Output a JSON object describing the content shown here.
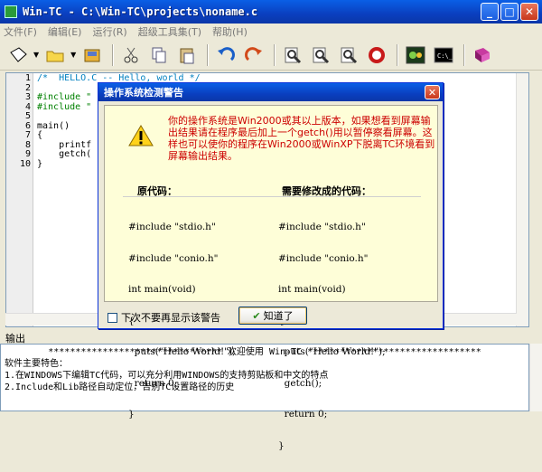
{
  "window": {
    "title": "Win-TC - C:\\Win-TC\\projects\\noname.c"
  },
  "menu": [
    "文件(F)",
    "编辑(E)",
    "运行(R)",
    "超级工具集(T)",
    "帮助(H)"
  ],
  "toolbar": {
    "icons": [
      "new-file-icon",
      "open-folder-icon",
      "save-disk-icon",
      "cut-icon",
      "copy-icon",
      "paste-icon",
      "undo-icon",
      "redo-icon",
      "find-icon",
      "find-next-icon",
      "replace-icon",
      "compile-run-icon",
      "build-icon",
      "dos-console-icon",
      "help-book-icon"
    ],
    "colors": {
      "accent": "#0a3fbf",
      "error": "#cc0000"
    }
  },
  "editor": {
    "line_numbers": [
      "1",
      "2",
      "3",
      "4",
      "5",
      "6",
      "7",
      "8",
      "9",
      "10"
    ],
    "lines": [
      "/*  HELLO.C -- Hello, world */",
      "",
      "#include \"",
      "#include \"",
      "",
      "main()",
      "{",
      "    printf",
      "    getch(",
      "}"
    ]
  },
  "dialog": {
    "title": "操作系统检测警告",
    "message": "你的操作系统是Win2000或其以上版本，如果想看到屏幕输出结果请在程序最后加上一个getch()用以暂停察看屏幕。这样也可以使你的程序在Win2000或WinXP下脱离TC环境看到屏幕输出结果。",
    "original_header": "原代码：",
    "modified_header": "需要修改成的代码：",
    "original_code": [
      "#include \"stdio.h\"",
      "#include \"conio.h\"",
      "int main(void)",
      "{",
      "  puts(\"Hello World!\");",
      "  return 0;",
      "}"
    ],
    "modified_code": [
      "#include \"stdio.h\"",
      "#include \"conio.h\"",
      "int main(void)",
      "{",
      "  puts(\"Hello World!\");",
      "  getch();",
      "  return 0;",
      "}"
    ],
    "checkbox_label": "下次不要再显示该警告",
    "ok_label": "知道了"
  },
  "output": {
    "label": "输出",
    "banner": "******************************** 欢迎使用 Win-TC ********************************",
    "lines": [
      "软件主要特色：",
      "1.在WINDOWS下编辑TC代码，可以充分利用WINDOWS的支持剪贴板和中文的特点",
      "2.Include和Lib路径自动定位，告别TC设置路径的历史"
    ]
  }
}
